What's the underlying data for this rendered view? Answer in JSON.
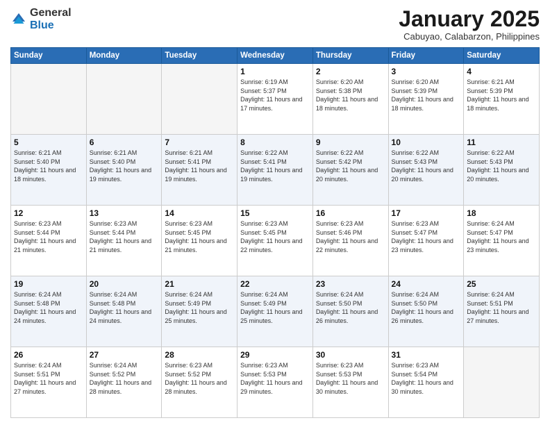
{
  "header": {
    "logo_general": "General",
    "logo_blue": "Blue",
    "month_title": "January 2025",
    "subtitle": "Cabuyao, Calabarzon, Philippines"
  },
  "days_of_week": [
    "Sunday",
    "Monday",
    "Tuesday",
    "Wednesday",
    "Thursday",
    "Friday",
    "Saturday"
  ],
  "weeks": [
    [
      {
        "day": "",
        "sunrise": "",
        "sunset": "",
        "daylight": ""
      },
      {
        "day": "",
        "sunrise": "",
        "sunset": "",
        "daylight": ""
      },
      {
        "day": "",
        "sunrise": "",
        "sunset": "",
        "daylight": ""
      },
      {
        "day": "1",
        "sunrise": "Sunrise: 6:19 AM",
        "sunset": "Sunset: 5:37 PM",
        "daylight": "Daylight: 11 hours and 17 minutes."
      },
      {
        "day": "2",
        "sunrise": "Sunrise: 6:20 AM",
        "sunset": "Sunset: 5:38 PM",
        "daylight": "Daylight: 11 hours and 18 minutes."
      },
      {
        "day": "3",
        "sunrise": "Sunrise: 6:20 AM",
        "sunset": "Sunset: 5:39 PM",
        "daylight": "Daylight: 11 hours and 18 minutes."
      },
      {
        "day": "4",
        "sunrise": "Sunrise: 6:21 AM",
        "sunset": "Sunset: 5:39 PM",
        "daylight": "Daylight: 11 hours and 18 minutes."
      }
    ],
    [
      {
        "day": "5",
        "sunrise": "Sunrise: 6:21 AM",
        "sunset": "Sunset: 5:40 PM",
        "daylight": "Daylight: 11 hours and 18 minutes."
      },
      {
        "day": "6",
        "sunrise": "Sunrise: 6:21 AM",
        "sunset": "Sunset: 5:40 PM",
        "daylight": "Daylight: 11 hours and 19 minutes."
      },
      {
        "day": "7",
        "sunrise": "Sunrise: 6:21 AM",
        "sunset": "Sunset: 5:41 PM",
        "daylight": "Daylight: 11 hours and 19 minutes."
      },
      {
        "day": "8",
        "sunrise": "Sunrise: 6:22 AM",
        "sunset": "Sunset: 5:41 PM",
        "daylight": "Daylight: 11 hours and 19 minutes."
      },
      {
        "day": "9",
        "sunrise": "Sunrise: 6:22 AM",
        "sunset": "Sunset: 5:42 PM",
        "daylight": "Daylight: 11 hours and 20 minutes."
      },
      {
        "day": "10",
        "sunrise": "Sunrise: 6:22 AM",
        "sunset": "Sunset: 5:43 PM",
        "daylight": "Daylight: 11 hours and 20 minutes."
      },
      {
        "day": "11",
        "sunrise": "Sunrise: 6:22 AM",
        "sunset": "Sunset: 5:43 PM",
        "daylight": "Daylight: 11 hours and 20 minutes."
      }
    ],
    [
      {
        "day": "12",
        "sunrise": "Sunrise: 6:23 AM",
        "sunset": "Sunset: 5:44 PM",
        "daylight": "Daylight: 11 hours and 21 minutes."
      },
      {
        "day": "13",
        "sunrise": "Sunrise: 6:23 AM",
        "sunset": "Sunset: 5:44 PM",
        "daylight": "Daylight: 11 hours and 21 minutes."
      },
      {
        "day": "14",
        "sunrise": "Sunrise: 6:23 AM",
        "sunset": "Sunset: 5:45 PM",
        "daylight": "Daylight: 11 hours and 21 minutes."
      },
      {
        "day": "15",
        "sunrise": "Sunrise: 6:23 AM",
        "sunset": "Sunset: 5:45 PM",
        "daylight": "Daylight: 11 hours and 22 minutes."
      },
      {
        "day": "16",
        "sunrise": "Sunrise: 6:23 AM",
        "sunset": "Sunset: 5:46 PM",
        "daylight": "Daylight: 11 hours and 22 minutes."
      },
      {
        "day": "17",
        "sunrise": "Sunrise: 6:23 AM",
        "sunset": "Sunset: 5:47 PM",
        "daylight": "Daylight: 11 hours and 23 minutes."
      },
      {
        "day": "18",
        "sunrise": "Sunrise: 6:24 AM",
        "sunset": "Sunset: 5:47 PM",
        "daylight": "Daylight: 11 hours and 23 minutes."
      }
    ],
    [
      {
        "day": "19",
        "sunrise": "Sunrise: 6:24 AM",
        "sunset": "Sunset: 5:48 PM",
        "daylight": "Daylight: 11 hours and 24 minutes."
      },
      {
        "day": "20",
        "sunrise": "Sunrise: 6:24 AM",
        "sunset": "Sunset: 5:48 PM",
        "daylight": "Daylight: 11 hours and 24 minutes."
      },
      {
        "day": "21",
        "sunrise": "Sunrise: 6:24 AM",
        "sunset": "Sunset: 5:49 PM",
        "daylight": "Daylight: 11 hours and 25 minutes."
      },
      {
        "day": "22",
        "sunrise": "Sunrise: 6:24 AM",
        "sunset": "Sunset: 5:49 PM",
        "daylight": "Daylight: 11 hours and 25 minutes."
      },
      {
        "day": "23",
        "sunrise": "Sunrise: 6:24 AM",
        "sunset": "Sunset: 5:50 PM",
        "daylight": "Daylight: 11 hours and 26 minutes."
      },
      {
        "day": "24",
        "sunrise": "Sunrise: 6:24 AM",
        "sunset": "Sunset: 5:50 PM",
        "daylight": "Daylight: 11 hours and 26 minutes."
      },
      {
        "day": "25",
        "sunrise": "Sunrise: 6:24 AM",
        "sunset": "Sunset: 5:51 PM",
        "daylight": "Daylight: 11 hours and 27 minutes."
      }
    ],
    [
      {
        "day": "26",
        "sunrise": "Sunrise: 6:24 AM",
        "sunset": "Sunset: 5:51 PM",
        "daylight": "Daylight: 11 hours and 27 minutes."
      },
      {
        "day": "27",
        "sunrise": "Sunrise: 6:24 AM",
        "sunset": "Sunset: 5:52 PM",
        "daylight": "Daylight: 11 hours and 28 minutes."
      },
      {
        "day": "28",
        "sunrise": "Sunrise: 6:23 AM",
        "sunset": "Sunset: 5:52 PM",
        "daylight": "Daylight: 11 hours and 28 minutes."
      },
      {
        "day": "29",
        "sunrise": "Sunrise: 6:23 AM",
        "sunset": "Sunset: 5:53 PM",
        "daylight": "Daylight: 11 hours and 29 minutes."
      },
      {
        "day": "30",
        "sunrise": "Sunrise: 6:23 AM",
        "sunset": "Sunset: 5:53 PM",
        "daylight": "Daylight: 11 hours and 30 minutes."
      },
      {
        "day": "31",
        "sunrise": "Sunrise: 6:23 AM",
        "sunset": "Sunset: 5:54 PM",
        "daylight": "Daylight: 11 hours and 30 minutes."
      },
      {
        "day": "",
        "sunrise": "",
        "sunset": "",
        "daylight": ""
      }
    ]
  ]
}
